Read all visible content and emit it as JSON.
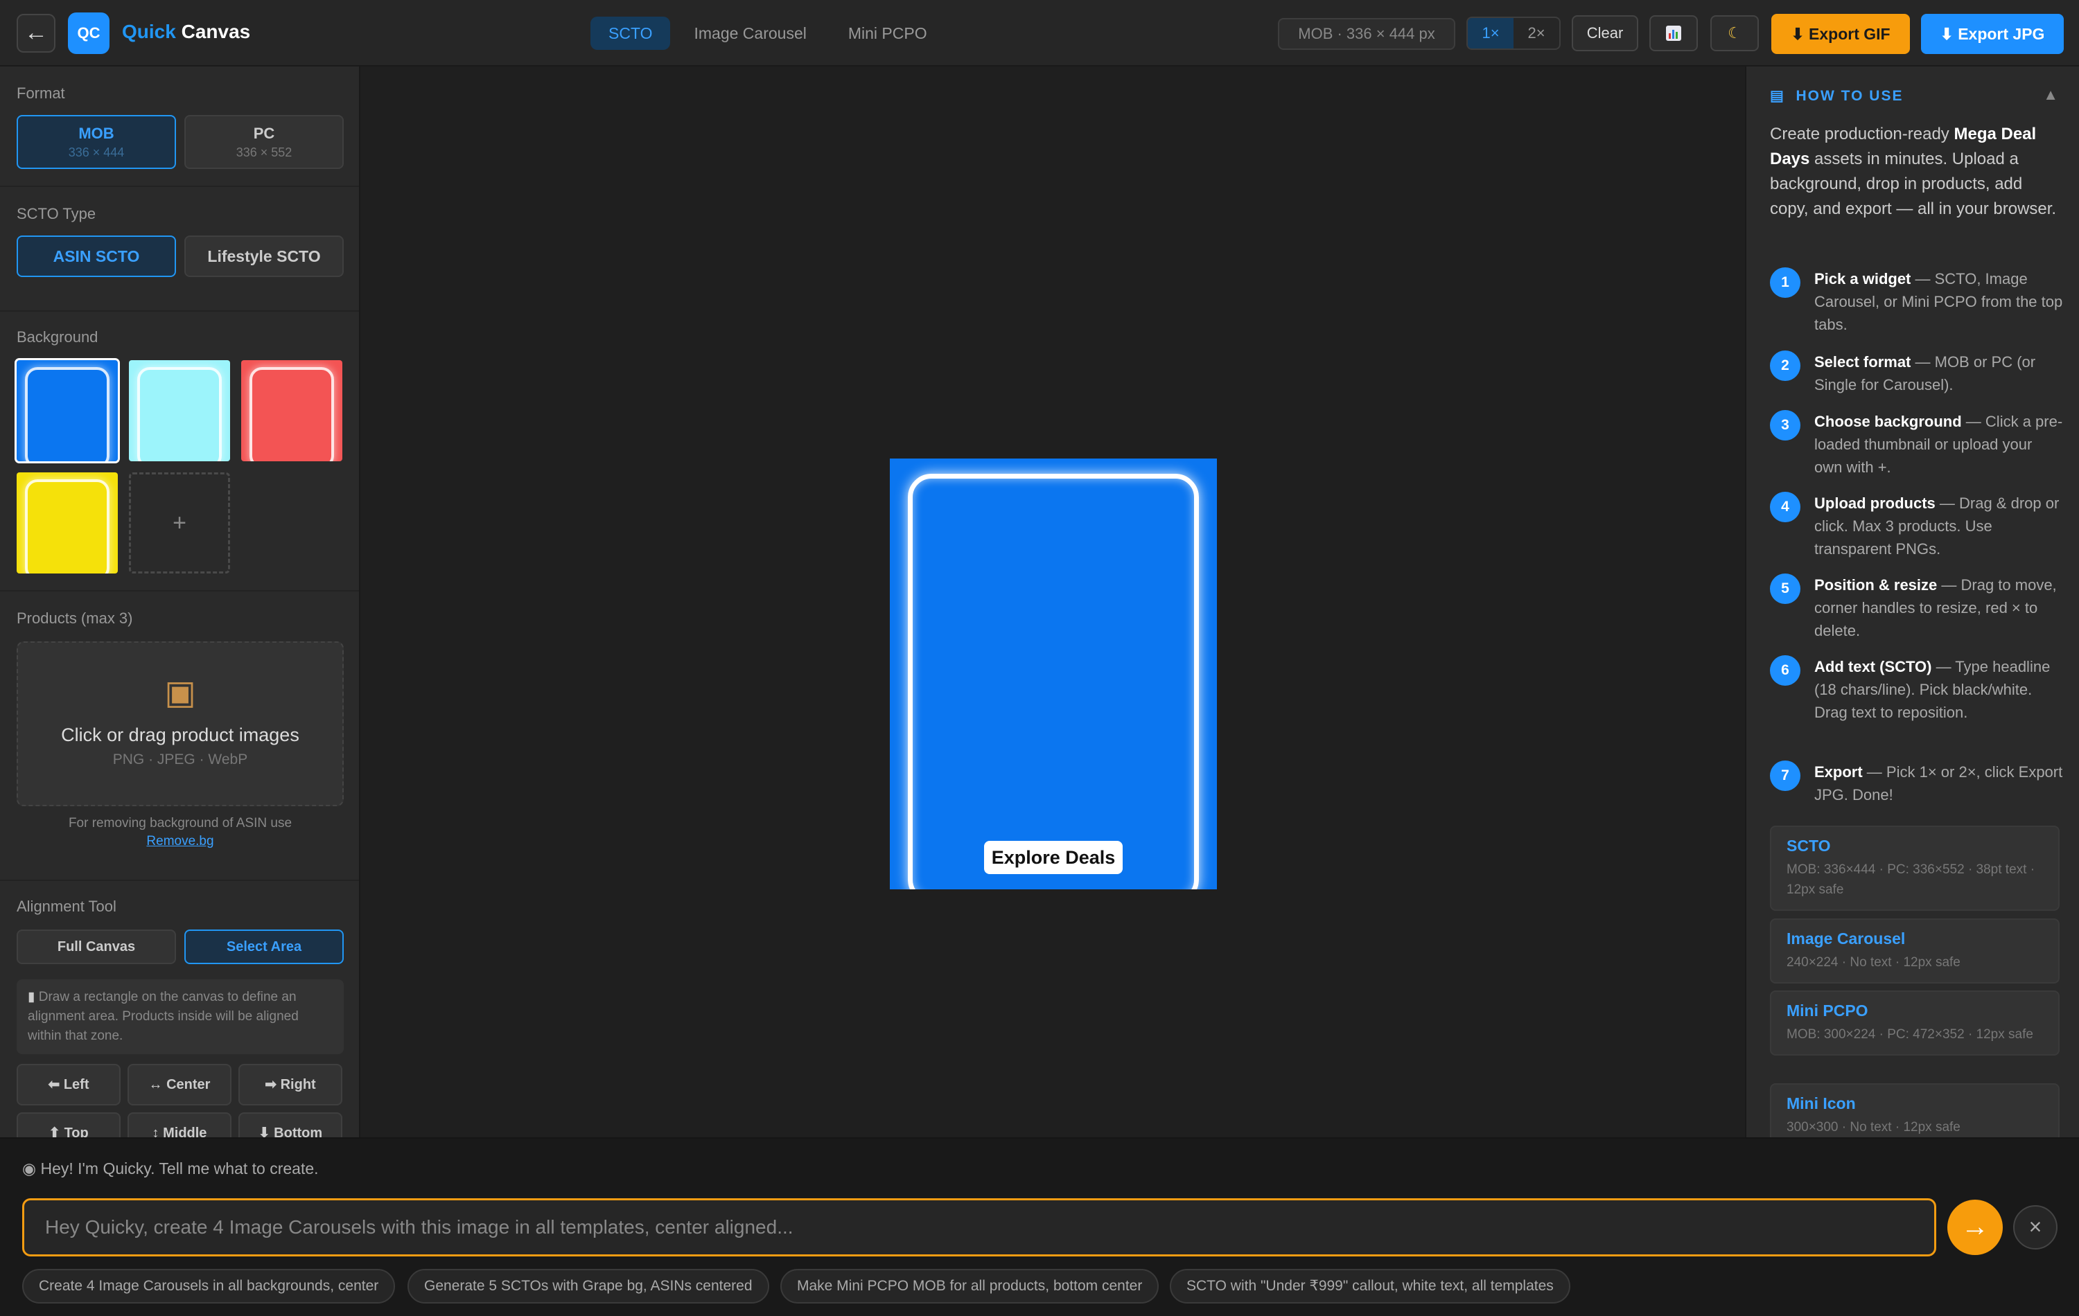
{
  "header": {
    "back_icon": "arrow-left-icon",
    "logo_text": "QC",
    "title_part1": "Quick",
    "title_part2": "Canvas",
    "tabs": [
      "SCTO",
      "Image Carousel",
      "Mini PCPO"
    ],
    "active_tab": "SCTO",
    "dimension_readout": "MOB · 336 × 444 px",
    "scale_options": [
      "1×",
      "2×"
    ],
    "active_scale": "1×",
    "clear_label": "Clear",
    "stats_icon": "bar-chart-icon",
    "theme_icon": "moon-icon",
    "export_gif_label": "⬇ Export GIF",
    "export_jpg_label": "⬇ Export JPG",
    "accent_color": "#2196f3",
    "export_gif_color": "#f79c0c"
  },
  "sidebar": {
    "format_label": "Format",
    "formats": [
      {
        "name": "MOB",
        "size": "336 × 444"
      },
      {
        "name": "PC",
        "size": "336 × 552"
      }
    ],
    "active_format": "MOB",
    "scto_type_label": "SCTO Type",
    "scto_types": [
      "ASIN SCTO",
      "Lifestyle SCTO"
    ],
    "active_scto_type": "ASIN SCTO",
    "background_label": "Background",
    "backgrounds": [
      {
        "color": "#0b76f0",
        "selected": true
      },
      {
        "color": "#9cf4fb",
        "selected": false
      },
      {
        "color": "#f35454",
        "selected": false
      },
      {
        "color": "#f5e10a",
        "selected": false
      }
    ],
    "add_background_label": "+",
    "products_label": "Products (max 3)",
    "dropzone_icon": "package-icon",
    "dropzone_title": "Click or drag product images",
    "dropzone_formats": "PNG · JPEG · WebP",
    "removebg_note": "For removing background of ASIN use",
    "removebg_link": "Remove.bg",
    "alignment_label": "Alignment Tool",
    "alignment_modes": [
      "Full Canvas",
      "Select Area"
    ],
    "active_alignment_mode": "Select Area",
    "alignment_hint": "Draw a rectangle on the canvas to define an alignment area. Products inside will be aligned within that zone.",
    "alignment_buttons": [
      "⬅ Left",
      "↔ Center",
      "➡ Right",
      "⬆ Top",
      "↕ Middle",
      "⬇ Bottom"
    ]
  },
  "canvas": {
    "background_color": "#0b76f0",
    "cta_label": "Explore Deals"
  },
  "how_to_use": {
    "title": "HOW TO USE",
    "toggle": "▲",
    "intro_prefix": "Create production-ready ",
    "intro_bold": "Mega Deal Days",
    "intro_suffix": " assets in minutes. Upload a background, drop in products, add copy, and export — all in your browser.",
    "steps": [
      {
        "num": "1",
        "title": "Pick a widget",
        "text": " — SCTO, Image Carousel, or Mini PCPO from the top tabs."
      },
      {
        "num": "2",
        "title": "Select format",
        "text": " — MOB or PC (or Single for Carousel)."
      },
      {
        "num": "3",
        "title": "Choose background",
        "text": " — Click a pre-loaded thumbnail or upload your own with +."
      },
      {
        "num": "4",
        "title": "Upload products",
        "text": " — Drag & drop or click. Max 3 products. Use transparent PNGs."
      },
      {
        "num": "5",
        "title": "Position & resize",
        "text": " — Drag to move, corner handles to resize, red × to delete."
      },
      {
        "num": "6",
        "title": "Add text (SCTO)",
        "text": " — Type headline (18 chars/line). Pick black/white. Drag text to reposition."
      },
      {
        "num": "7",
        "title": "Export",
        "text": " — Pick 1× or 2×, click Export JPG. Done!"
      }
    ],
    "widgets": [
      {
        "title": "SCTO",
        "desc": "MOB: 336×444 · PC: 336×552 · 38pt text · 12px safe"
      },
      {
        "title": "Image Carousel",
        "desc": "240×224 · No text · 12px safe"
      },
      {
        "title": "Mini PCPO",
        "desc": "MOB: 300×224 · PC: 472×352 · 12px safe"
      },
      {
        "title": "Mini Icon",
        "desc": "300×300 · No text · 12px safe"
      }
    ]
  },
  "chat": {
    "bot_icon": "robot-icon",
    "greeting": "Hey! I'm Quicky. Tell me what to create.",
    "placeholder": "Hey Quicky, create 4 Image Carousels with this image in all templates, center aligned...",
    "value": "",
    "send_icon": "arrow-right-icon",
    "close_icon": "close-icon",
    "suggestions": [
      "Create 4 Image Carousels in all backgrounds, center",
      "Generate 5 SCTOs with Grape bg, ASINs centered",
      "Make Mini PCPO MOB for all products, bottom center",
      "SCTO with \"Under ₹999\" callout, white text, all templates"
    ]
  }
}
